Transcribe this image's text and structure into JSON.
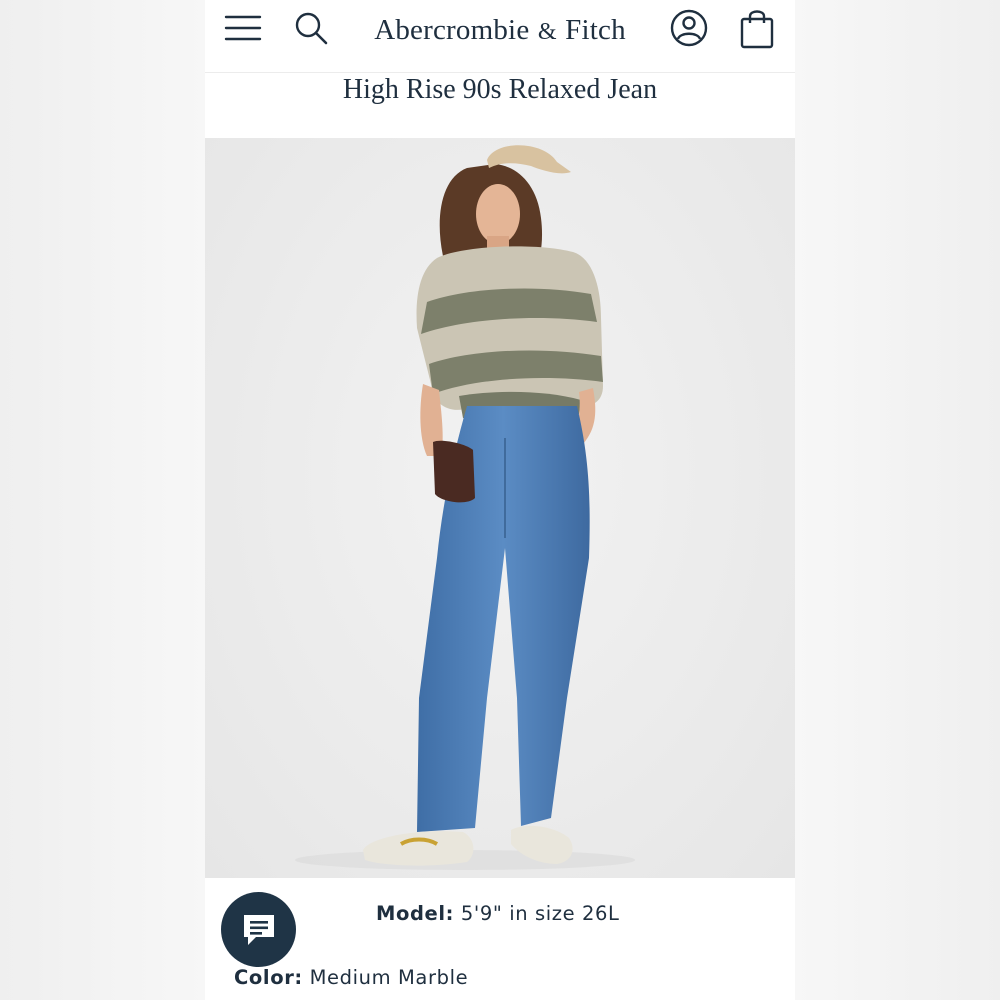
{
  "header": {
    "brand_main": "Abercrombie",
    "brand_amp": "&",
    "brand_end": "Fitch"
  },
  "product": {
    "title": "High Rise 90s Relaxed Jean",
    "model_label": "Model:",
    "model_value": "5'9\" in size 26L",
    "color_label": "Color:",
    "color_value": "Medium Marble"
  },
  "icons": {
    "menu": "menu-icon",
    "search": "search-icon",
    "account": "account-icon",
    "bag": "shopping-bag-icon",
    "chat": "chat-icon"
  },
  "colors": {
    "brand_navy": "#1f2f3f",
    "chat_bg": "#1f3446"
  }
}
